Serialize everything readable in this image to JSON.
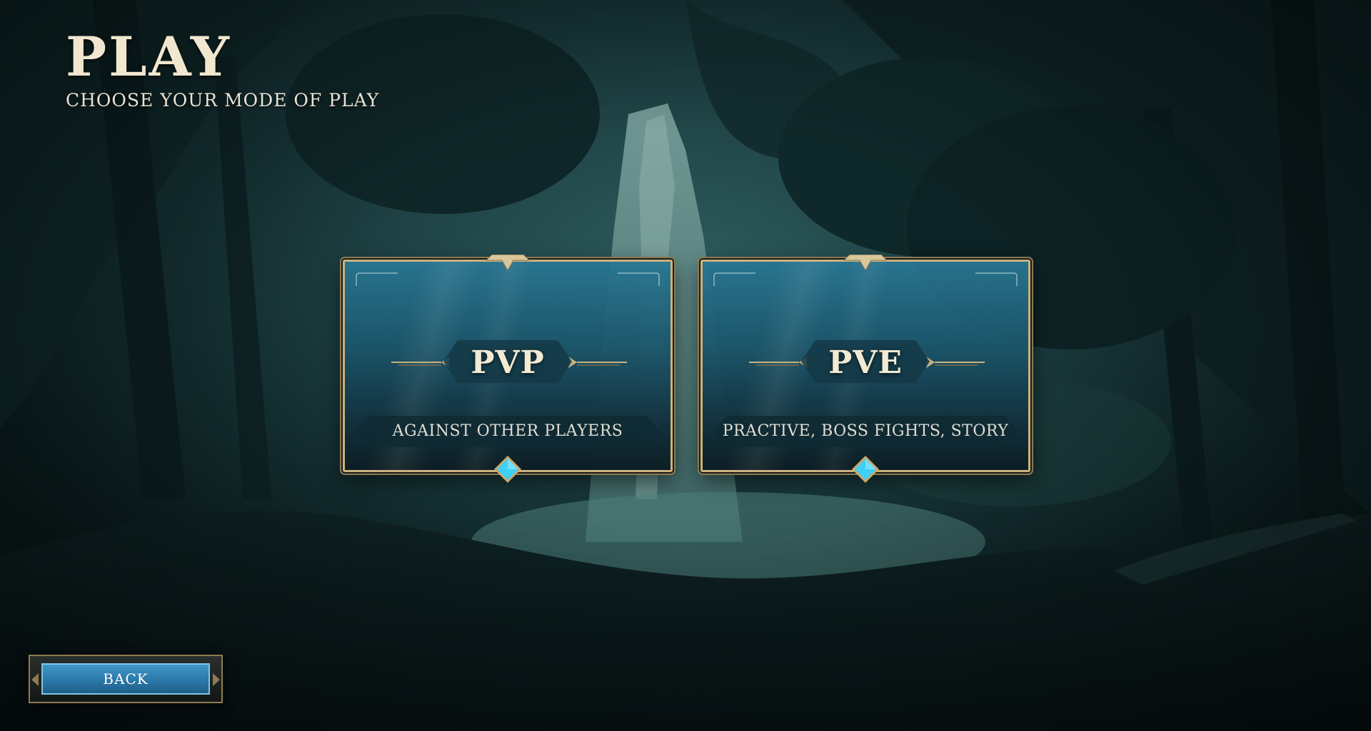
{
  "header": {
    "title": "PLAY",
    "subtitle": "CHOOSE YOUR MODE OF PLAY"
  },
  "modes": [
    {
      "title": "PVP",
      "description": "AGAINST OTHER PLAYERS"
    },
    {
      "title": "PVE",
      "description": "PRACTIVE, BOSS FIGHTS, STORY"
    }
  ],
  "back_button": {
    "label": "BACK"
  },
  "colors": {
    "gold": "#c9b27f",
    "card_blue": "#29768f",
    "gem_cyan": "#3fd0f5",
    "button_blue": "#2b78a9"
  }
}
